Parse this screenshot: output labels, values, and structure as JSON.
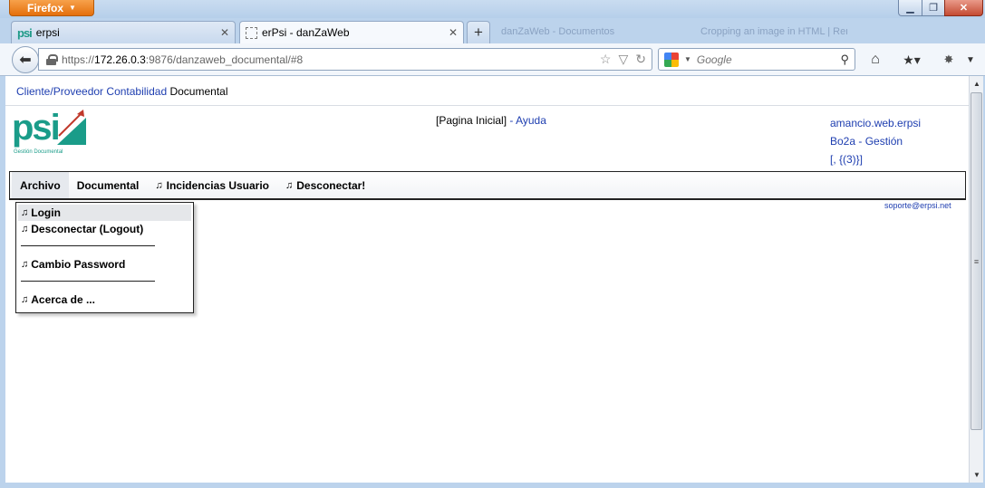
{
  "browser": {
    "app_button": "Firefox",
    "tabs": [
      {
        "title": "erpsi",
        "favicon": "psi"
      },
      {
        "title": "erPsi - danZaWeb",
        "favicon": "blank"
      }
    ],
    "ghost_tabs": [
      "danZaWeb - Documentos",
      "Cropping an image in HTML | Remo..."
    ],
    "url": {
      "prefix": "https://",
      "host": "172.26.0.3",
      "rest": ":9876/danzaweb_documental/#8"
    },
    "search_placeholder": "Google"
  },
  "page": {
    "top_links": {
      "item1": "Cliente/Proveedor",
      "item2": "Contabilidad",
      "item3": "Documental"
    },
    "logo": {
      "text": "psi",
      "subtitle": "Gestión Documental",
      "color": "#1a9c89"
    },
    "center": {
      "home_link": "[Pagina Inicial]",
      "separator": "-",
      "help_link": "Ayuda"
    },
    "user": {
      "name": "amancio.web.erpsi",
      "company": "Bo2a - Gestión",
      "extra": "[, {(3)}]"
    },
    "menu": {
      "archivo": "Archivo",
      "documental": "Documental",
      "incidencias": "Incidencias Usuario",
      "desconectar": "Desconectar!"
    },
    "support_email": "soporte@erpsi.net",
    "dropdown": {
      "login": "Login",
      "logout": "Desconectar (Logout)",
      "password": "Cambio Password",
      "about": "Acerca de ..."
    }
  },
  "colors": {
    "link": "#1e3eb0",
    "firefox_orange": "#e4700d"
  }
}
